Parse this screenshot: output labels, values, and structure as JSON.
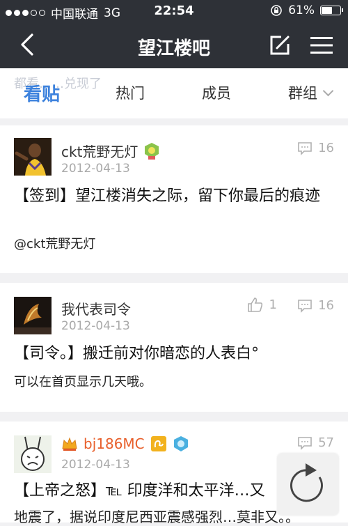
{
  "status_bar": {
    "carrier": "中国联通",
    "network": "3G",
    "time": "22:54",
    "battery": "61%",
    "battery_level": 0.61
  },
  "nav": {
    "title": "望江楼吧",
    "back_icon": "chevron-left-icon",
    "edit_icon": "edit-icon",
    "menu_icon": "menu-icon"
  },
  "tabs": {
    "ghost_text": "都看……兑现了",
    "items": [
      "看贴",
      "热门",
      "成员",
      "群组"
    ]
  },
  "posts": [
    {
      "user": "ckt荒野无灯",
      "date": "2012-04-13",
      "comments": "16",
      "title": "【签到】望江楼消失之际，留下你最后的痕迹",
      "subtitle": "@ckt荒野无灯"
    },
    {
      "user": "我代表司令",
      "date": "2012-04-13",
      "likes": "1",
      "comments": "16",
      "title": "【司令。】搬迁前对你暗恋的人表白°",
      "subtitle": "可以在首页显示几天哦。"
    },
    {
      "user": "bj186MC",
      "date": "2012-04-13",
      "comments": "57",
      "title": "【上帝之怒】℡ 印度洋和太平洋…又",
      "subtitle": "地震了，据说印度尼西亚震感强烈…莫非又。。"
    }
  ],
  "colors": {
    "bar": "#2e3137",
    "accent": "#3d82dd",
    "username_vip": "#e8602c"
  }
}
